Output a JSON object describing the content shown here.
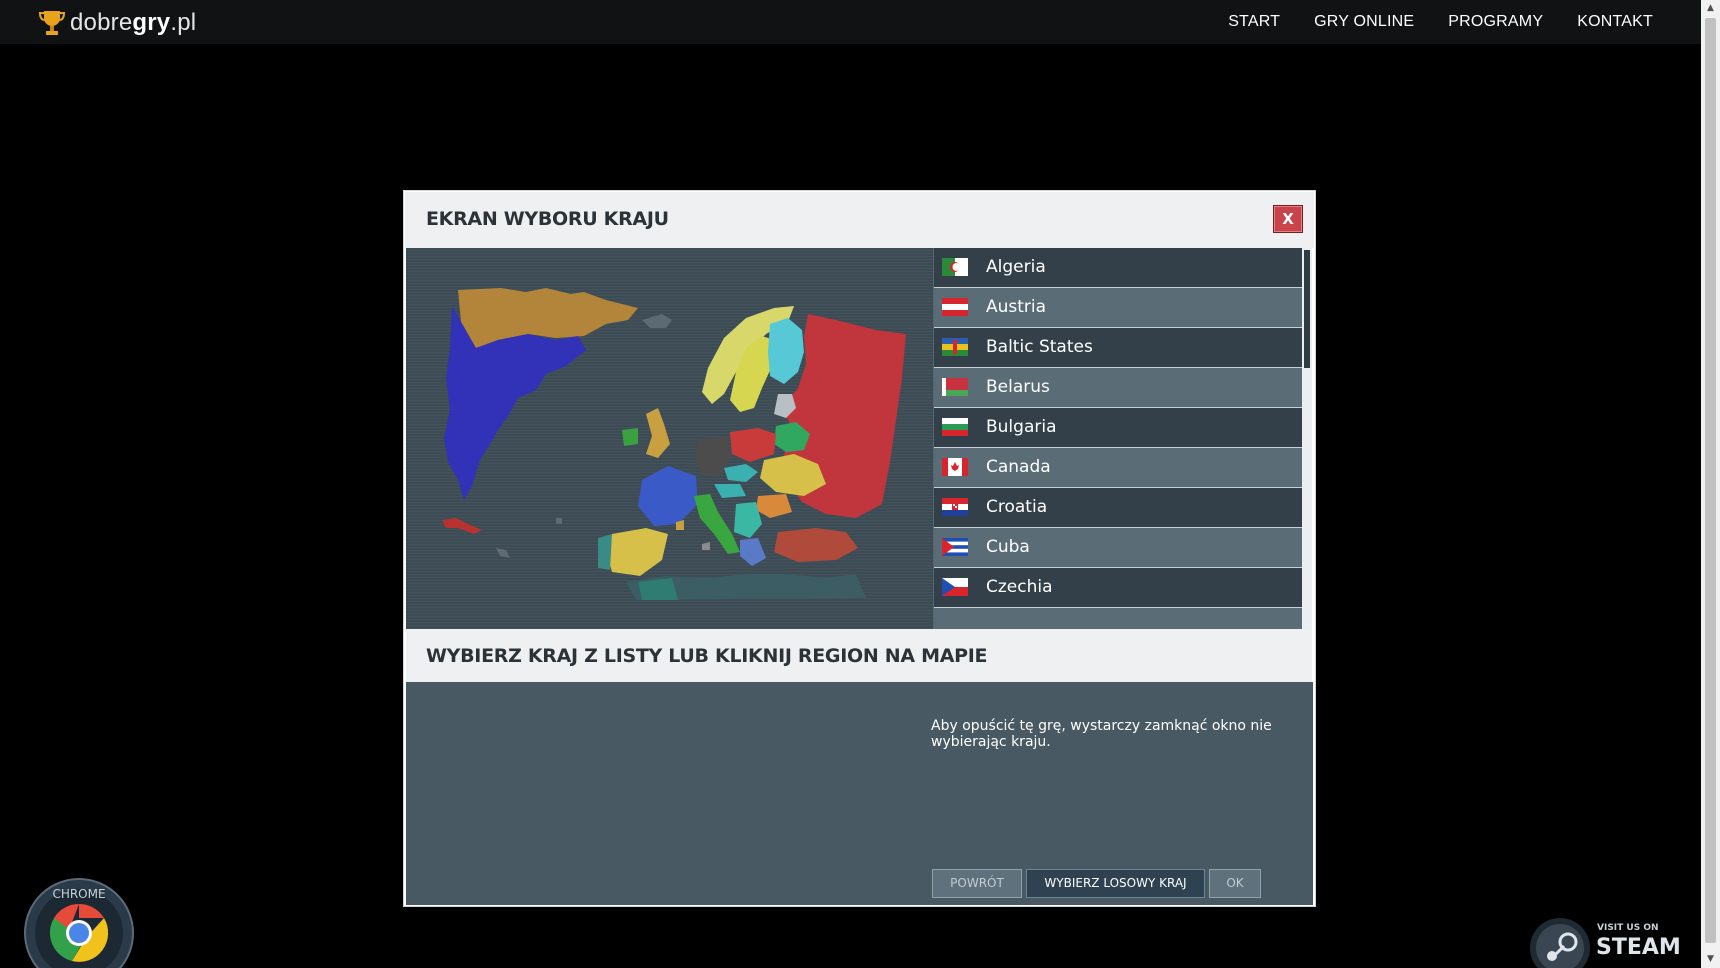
{
  "site": {
    "logo_prefix": "dobre",
    "logo_bold": "gry",
    "logo_suffix": ".pl",
    "nav": [
      "START",
      "GRY ONLINE",
      "PROGRAMY",
      "KONTAKT"
    ]
  },
  "modal": {
    "title": "EKRAN WYBORU KRAJU",
    "close_label": "X",
    "instruction": "WYBIERZ KRAJ Z LISTY LUB KLIKNIJ REGION NA MAPIE",
    "exit_note": "Aby opuścić tę grę, wystarczy zamknąć okno nie wybierając kraju.",
    "countries": [
      {
        "name": "Algeria",
        "flag": "algeria-flag"
      },
      {
        "name": "Austria",
        "flag": "austria-flag"
      },
      {
        "name": "Baltic States",
        "flag": "baltic-states-flag"
      },
      {
        "name": "Belarus",
        "flag": "belarus-flag"
      },
      {
        "name": "Bulgaria",
        "flag": "bulgaria-flag"
      },
      {
        "name": "Canada",
        "flag": "canada-flag"
      },
      {
        "name": "Croatia",
        "flag": "croatia-flag"
      },
      {
        "name": "Cuba",
        "flag": "cuba-flag"
      },
      {
        "name": "Czechia",
        "flag": "czechia-flag"
      }
    ],
    "buttons": {
      "back": "POWRÓT",
      "random": "WYBIERZ LOSOWY KRAJ",
      "ok": "OK"
    }
  },
  "badges": {
    "chrome_top": "CHROME",
    "steam_small": "VISIT US ON",
    "steam_big": "STEAM"
  }
}
